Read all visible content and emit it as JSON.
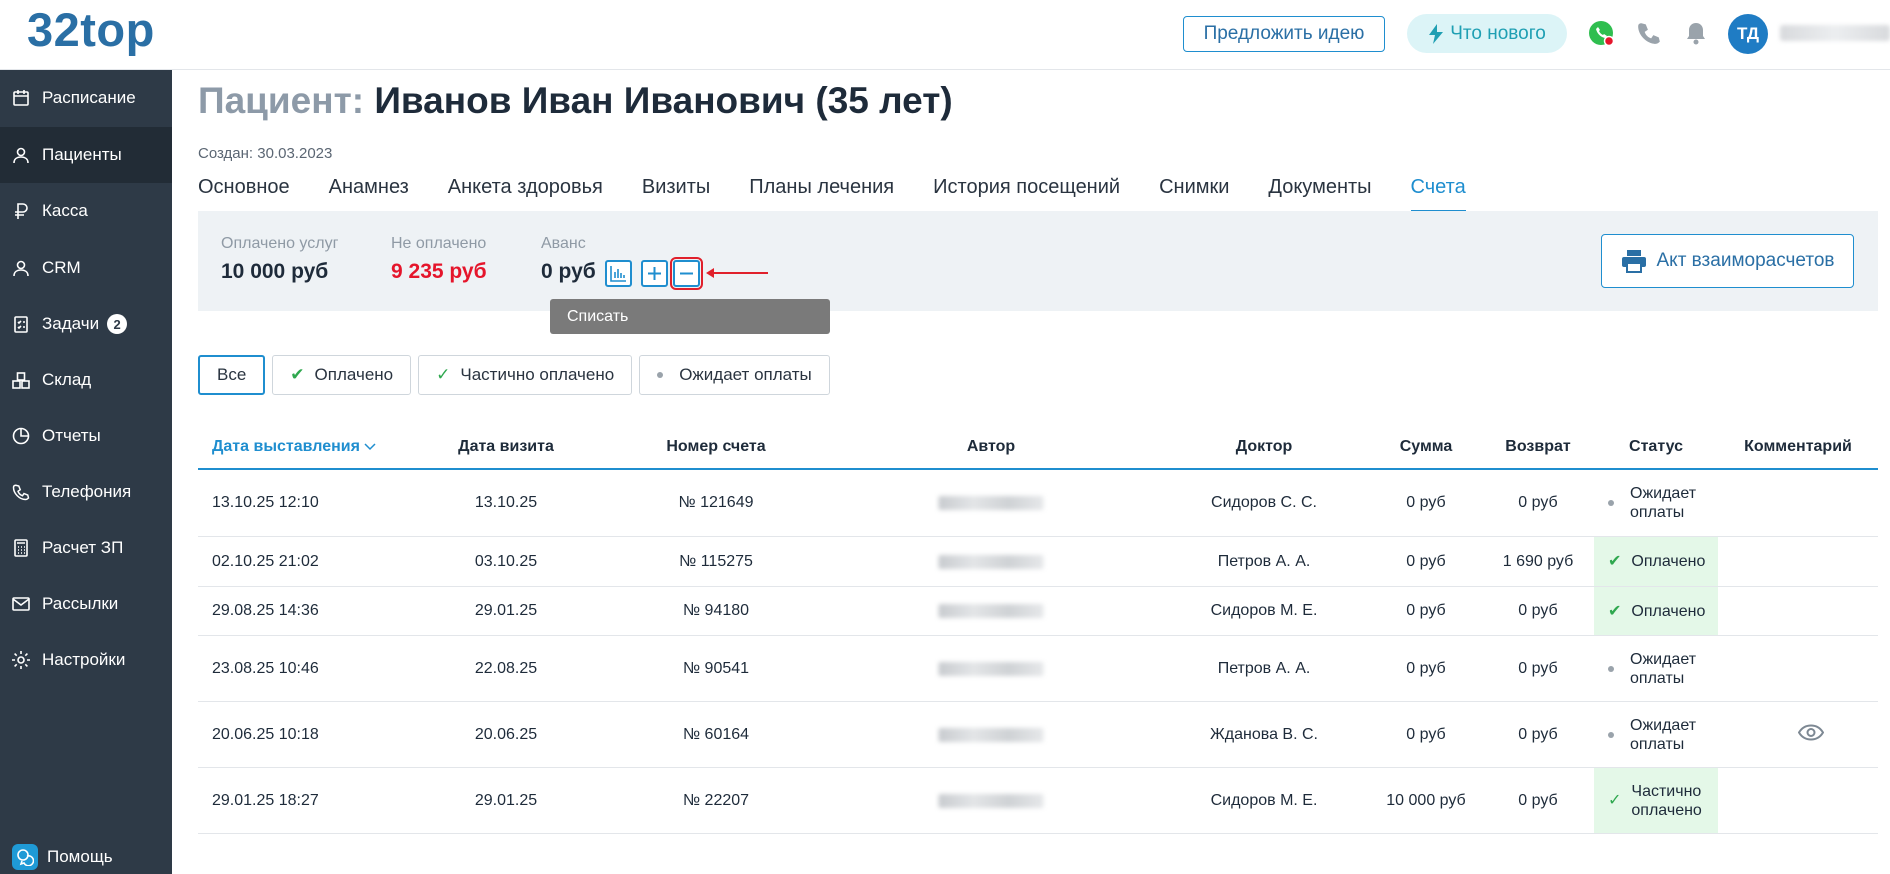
{
  "header": {
    "logo": "32top",
    "idea_button": "Предложить идею",
    "news_button": "Что нового",
    "avatar_initials": "ТД"
  },
  "sidebar": {
    "items": [
      {
        "label": "Расписание",
        "icon": "calendar-icon"
      },
      {
        "label": "Пациенты",
        "icon": "user-icon",
        "active": true
      },
      {
        "label": "Касса",
        "icon": "ruble-icon"
      },
      {
        "label": "CRM",
        "icon": "user-icon"
      },
      {
        "label": "Задачи",
        "icon": "clipboard-icon",
        "badge": "2"
      },
      {
        "label": "Склад",
        "icon": "boxes-icon"
      },
      {
        "label": "Отчеты",
        "icon": "pie-chart-icon"
      },
      {
        "label": "Телефония",
        "icon": "phone-icon"
      },
      {
        "label": "Расчет ЗП",
        "icon": "calculator-icon"
      },
      {
        "label": "Рассылки",
        "icon": "mail-icon"
      },
      {
        "label": "Настройки",
        "icon": "gear-icon"
      }
    ],
    "help": "Помощь"
  },
  "patient": {
    "title_label": "Пациент:",
    "title_name": "Иванов Иван Иванович (35 лет)",
    "created": "Создан: 30.03.2023"
  },
  "tabs": [
    "Основное",
    "Анамнез",
    "Анкета здоровья",
    "Визиты",
    "Планы лечения",
    "История посещений",
    "Снимки",
    "Документы",
    "Счета"
  ],
  "active_tab": "Счета",
  "summary": {
    "paid_label": "Оплачено услуг",
    "paid_value": "10 000 руб",
    "unpaid_label": "Не оплачено",
    "unpaid_value": "9 235 руб",
    "advance_label": "Аванс",
    "advance_value": "0 руб",
    "tooltip": "Списать",
    "act_button": "Акт взаиморасчетов"
  },
  "filters": {
    "all": "Все",
    "paid": "Оплачено",
    "partial": "Частично оплачено",
    "pending": "Ожидает оплаты"
  },
  "table": {
    "columns": [
      "Дата выставления",
      "Дата визита",
      "Номер счета",
      "Автор",
      "Доктор",
      "Сумма",
      "Возврат",
      "Статус",
      "Комментарий"
    ],
    "rows": [
      {
        "issued": "13.10.25 12:10",
        "visit": "13.10.25",
        "number": "№ 121649",
        "doctor": "Сидоров С. С.",
        "sum": "0 руб",
        "refund": "0 руб",
        "status1": "Ожидает",
        "status2": "оплаты",
        "status_type": "pending",
        "comment": ""
      },
      {
        "issued": "02.10.25 21:02",
        "visit": "03.10.25",
        "number": "№ 115275",
        "doctor": "Петров А. А.",
        "sum": "0 руб",
        "refund": "1 690 руб",
        "status1": "Оплачено",
        "status2": "",
        "status_type": "paid",
        "comment": ""
      },
      {
        "issued": "29.08.25 14:36",
        "visit": "29.01.25",
        "number": "№ 94180",
        "doctor": "Сидоров М. Е.",
        "sum": "0 руб",
        "refund": "0 руб",
        "status1": "Оплачено",
        "status2": "",
        "status_type": "paid",
        "comment": ""
      },
      {
        "issued": "23.08.25 10:46",
        "visit": "22.08.25",
        "number": "№ 90541",
        "doctor": "Петров А. А.",
        "sum": "0 руб",
        "refund": "0 руб",
        "status1": "Ожидает",
        "status2": "оплаты",
        "status_type": "pending",
        "comment": ""
      },
      {
        "issued": "20.06.25 10:18",
        "visit": "20.06.25",
        "number": "№ 60164",
        "doctor": "Жданова В. С.",
        "sum": "0 руб",
        "refund": "0 руб",
        "status1": "Ожидает",
        "status2": "оплаты",
        "status_type": "pending",
        "comment": "eye-icon"
      },
      {
        "issued": "29.01.25 18:27",
        "visit": "29.01.25",
        "number": "№ 22207",
        "doctor": "Сидоров М. Е.",
        "sum": "10 000 руб",
        "refund": "0 руб",
        "status1": "Частично",
        "status2": "оплачено",
        "status_type": "partial",
        "comment": ""
      }
    ]
  },
  "colors": {
    "accent": "#1f8ecf",
    "sidebar": "#2e3a47",
    "red": "#e5152b",
    "green": "#2fa84f"
  }
}
